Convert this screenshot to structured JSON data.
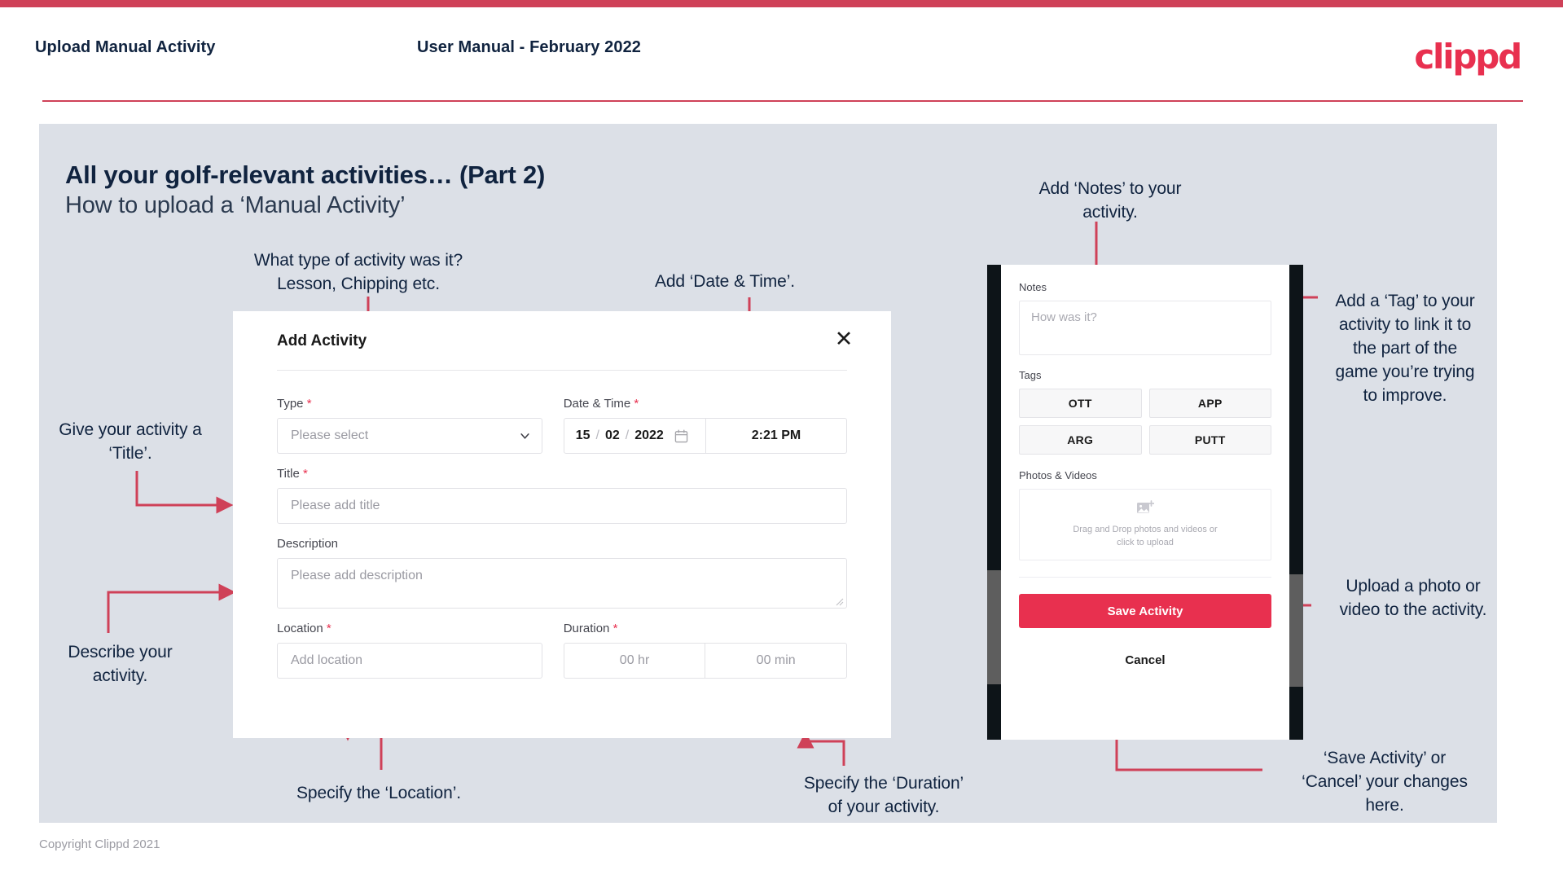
{
  "header": {
    "left_title": "Upload Manual Activity",
    "center_title": "User Manual - February 2022",
    "logo": "clippd"
  },
  "slide": {
    "title_bold": "All your golf-relevant activities… (Part 2)",
    "title_sub": "How to upload a ‘Manual Activity’"
  },
  "annotations": {
    "type": "What type of activity was it?\nLesson, Chipping etc.",
    "datetime": "Add ‘Date & Time’.",
    "notes": "Add ‘Notes’ to your\nactivity.",
    "tag": "Add a ‘Tag’ to your\nactivity to link it to\nthe part of the\ngame you’re trying\nto improve.",
    "title": "Give your activity a\n‘Title’.",
    "description": "Describe your\nactivity.",
    "location": "Specify the ‘Location’.",
    "duration": "Specify the ‘Duration’\nof your activity.",
    "upload": "Upload a photo or\nvideo to the activity.",
    "save_cancel": "‘Save Activity’ or\n‘Cancel’ your changes\nhere."
  },
  "modal": {
    "title": "Add Activity",
    "close_icon": "✕",
    "fields": {
      "type": {
        "label": "Type",
        "required": "*",
        "placeholder": "Please select"
      },
      "datetime": {
        "label": "Date & Time",
        "required": "*",
        "day": "15",
        "sep1": "/",
        "month": "02",
        "sep2": "/",
        "year": "2022",
        "time": "2:21 PM"
      },
      "title": {
        "label": "Title",
        "required": "*",
        "placeholder": "Please add title"
      },
      "description": {
        "label": "Description",
        "placeholder": "Please add description"
      },
      "location": {
        "label": "Location",
        "required": "*",
        "placeholder": "Add location"
      },
      "duration": {
        "label": "Duration",
        "required": "*",
        "hours_placeholder": "00 hr",
        "minutes_placeholder": "00 min"
      }
    }
  },
  "phone": {
    "notes_label": "Notes",
    "notes_placeholder": "How was it?",
    "tags_label": "Tags",
    "tags": [
      "OTT",
      "APP",
      "ARG",
      "PUTT"
    ],
    "photos_label": "Photos & Videos",
    "dropzone_line1": "Drag and Drop photos and videos or",
    "dropzone_line2": "click to upload",
    "save_label": "Save Activity",
    "cancel_label": "Cancel"
  },
  "footer": {
    "copyright": "Copyright Clippd 2021"
  },
  "colors": {
    "accent": "#e8304f",
    "accent_bar": "#cf4158",
    "slide_bg": "#dce0e7",
    "text_dark": "#10233f"
  }
}
